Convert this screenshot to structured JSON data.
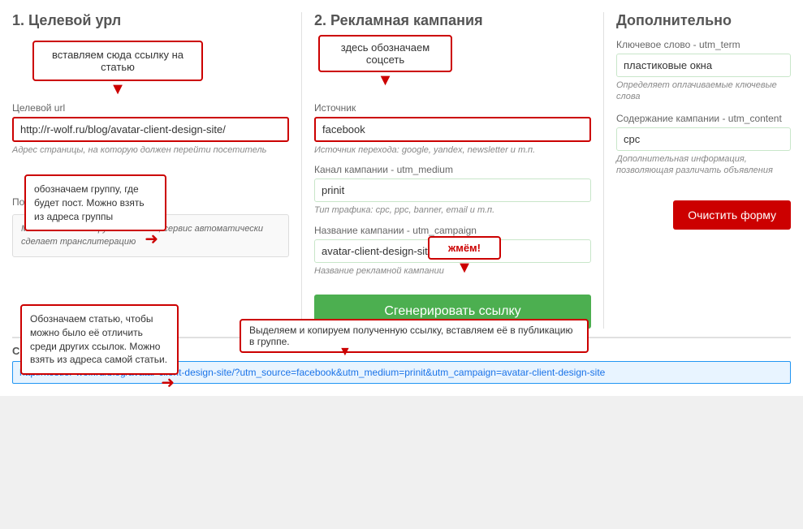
{
  "sections": {
    "section1": {
      "title": "1. Целевой урл",
      "url_label": "Целевой url",
      "url_value": "http://r-wolf.ru/blog/avatar-client-design-site/",
      "url_hint": "Адрес страницы, на которую должен перейти посетитель",
      "podsk_label": "Подс...",
      "podsk_hint": "Можно писать на русском языке, сервис автоматически сделает транслитерацию",
      "tooltip1": "вставляем сюда ссылку на статью"
    },
    "section2": {
      "title": "2. Рекламная кампания",
      "source_label": "Источник",
      "source_value": "facebook",
      "source_hint": "Источник перехода: google, yandex, newsletter и т.п.",
      "medium_label": "Канал кампании - utm_medium",
      "medium_value": "prinit",
      "medium_hint": "Тип трафика: cpc, ppc, banner, email и т.п.",
      "campaign_label": "Название кампании - utm_campaign",
      "campaign_value": "avatar-client-design-site",
      "campaign_hint": "Название рекламной кампании",
      "generate_btn": "Сгенерировать ссылку",
      "tooltip2": "здесь обозначаем соцсеть",
      "tooltip3": "обозначаем группу, где будет пост. Можно взять из адреса группы",
      "tooltip4": "Обозначаем статью, чтобы можно было её отличить среди других ссылок. Можно взять из адреса самой статьи.",
      "tooltip5": "жмём!"
    },
    "extra": {
      "title": "Дополнительно",
      "keyword_label": "Ключевое слово - utm_term",
      "keyword_value": "пластиковые окна",
      "keyword_hint": "Определяет оплачиваемые ключевые слова",
      "content_label": "Содержание кампании - utm_content",
      "content_value": "cpc",
      "content_hint": "Дополнительная информация, позволяющая различать объявления",
      "clear_btn": "Очистить форму"
    },
    "bottom": {
      "label": "Сгенерированная ссылка",
      "link": "http://kestler-wolf.ru/blog/avatar-client-design-site/?utm_source=facebook&utm_medium=prinit&utm_campaign=avatar-client-design-site",
      "tooltip": "Выделяем и копируем полученную ссылку, вставляем её в публикацию в группе."
    }
  }
}
